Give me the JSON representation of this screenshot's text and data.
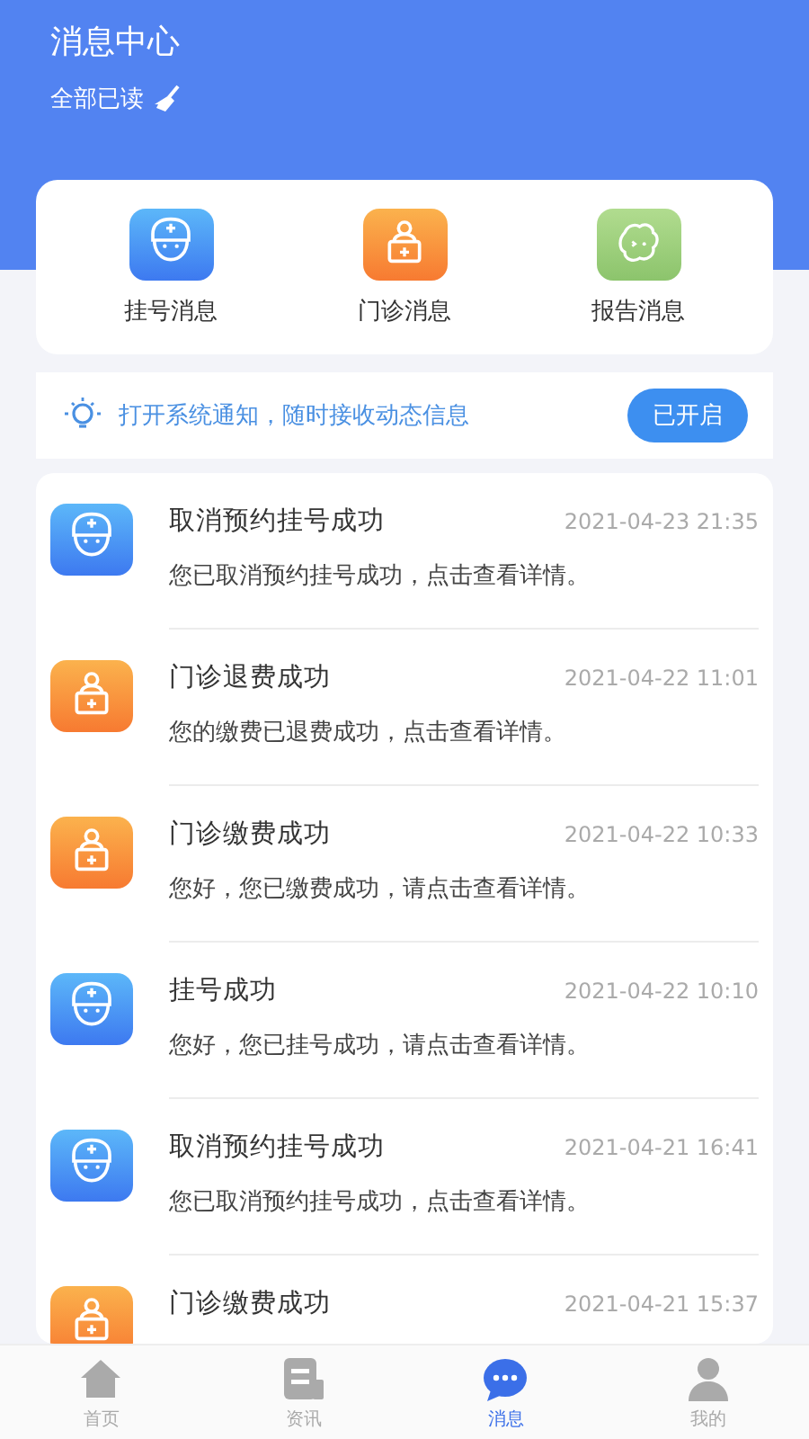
{
  "header": {
    "title": "消息中心",
    "mark_all_read": "全部已读"
  },
  "categories": [
    {
      "kind": "registration",
      "label": "挂号消息"
    },
    {
      "kind": "clinic",
      "label": "门诊消息"
    },
    {
      "kind": "report",
      "label": "报告消息"
    }
  ],
  "notice": {
    "text": "打开系统通知，随时接收动态信息",
    "button": "已开启"
  },
  "messages": [
    {
      "kind": "registration",
      "title": "取消预约挂号成功",
      "time": "2021-04-23 21:35",
      "body": "您已取消预约挂号成功，点击查看详情。"
    },
    {
      "kind": "clinic",
      "title": "门诊退费成功",
      "time": "2021-04-22 11:01",
      "body": "您的缴费已退费成功，点击查看详情。"
    },
    {
      "kind": "clinic",
      "title": "门诊缴费成功",
      "time": "2021-04-22 10:33",
      "body": "您好，您已缴费成功，请点击查看详情。"
    },
    {
      "kind": "registration",
      "title": "挂号成功",
      "time": "2021-04-22 10:10",
      "body": "您好，您已挂号成功，请点击查看详情。"
    },
    {
      "kind": "registration",
      "title": "取消预约挂号成功",
      "time": "2021-04-21 16:41",
      "body": "您已取消预约挂号成功，点击查看详情。"
    },
    {
      "kind": "clinic",
      "title": "门诊缴费成功",
      "time": "2021-04-21 15:37"
    }
  ],
  "tab_bar": [
    {
      "kind": "home",
      "label": "首页",
      "selected": false
    },
    {
      "kind": "news",
      "label": "资讯",
      "selected": false
    },
    {
      "kind": "messages",
      "label": "消息",
      "selected": true
    },
    {
      "kind": "profile",
      "label": "我的",
      "selected": false
    }
  ]
}
